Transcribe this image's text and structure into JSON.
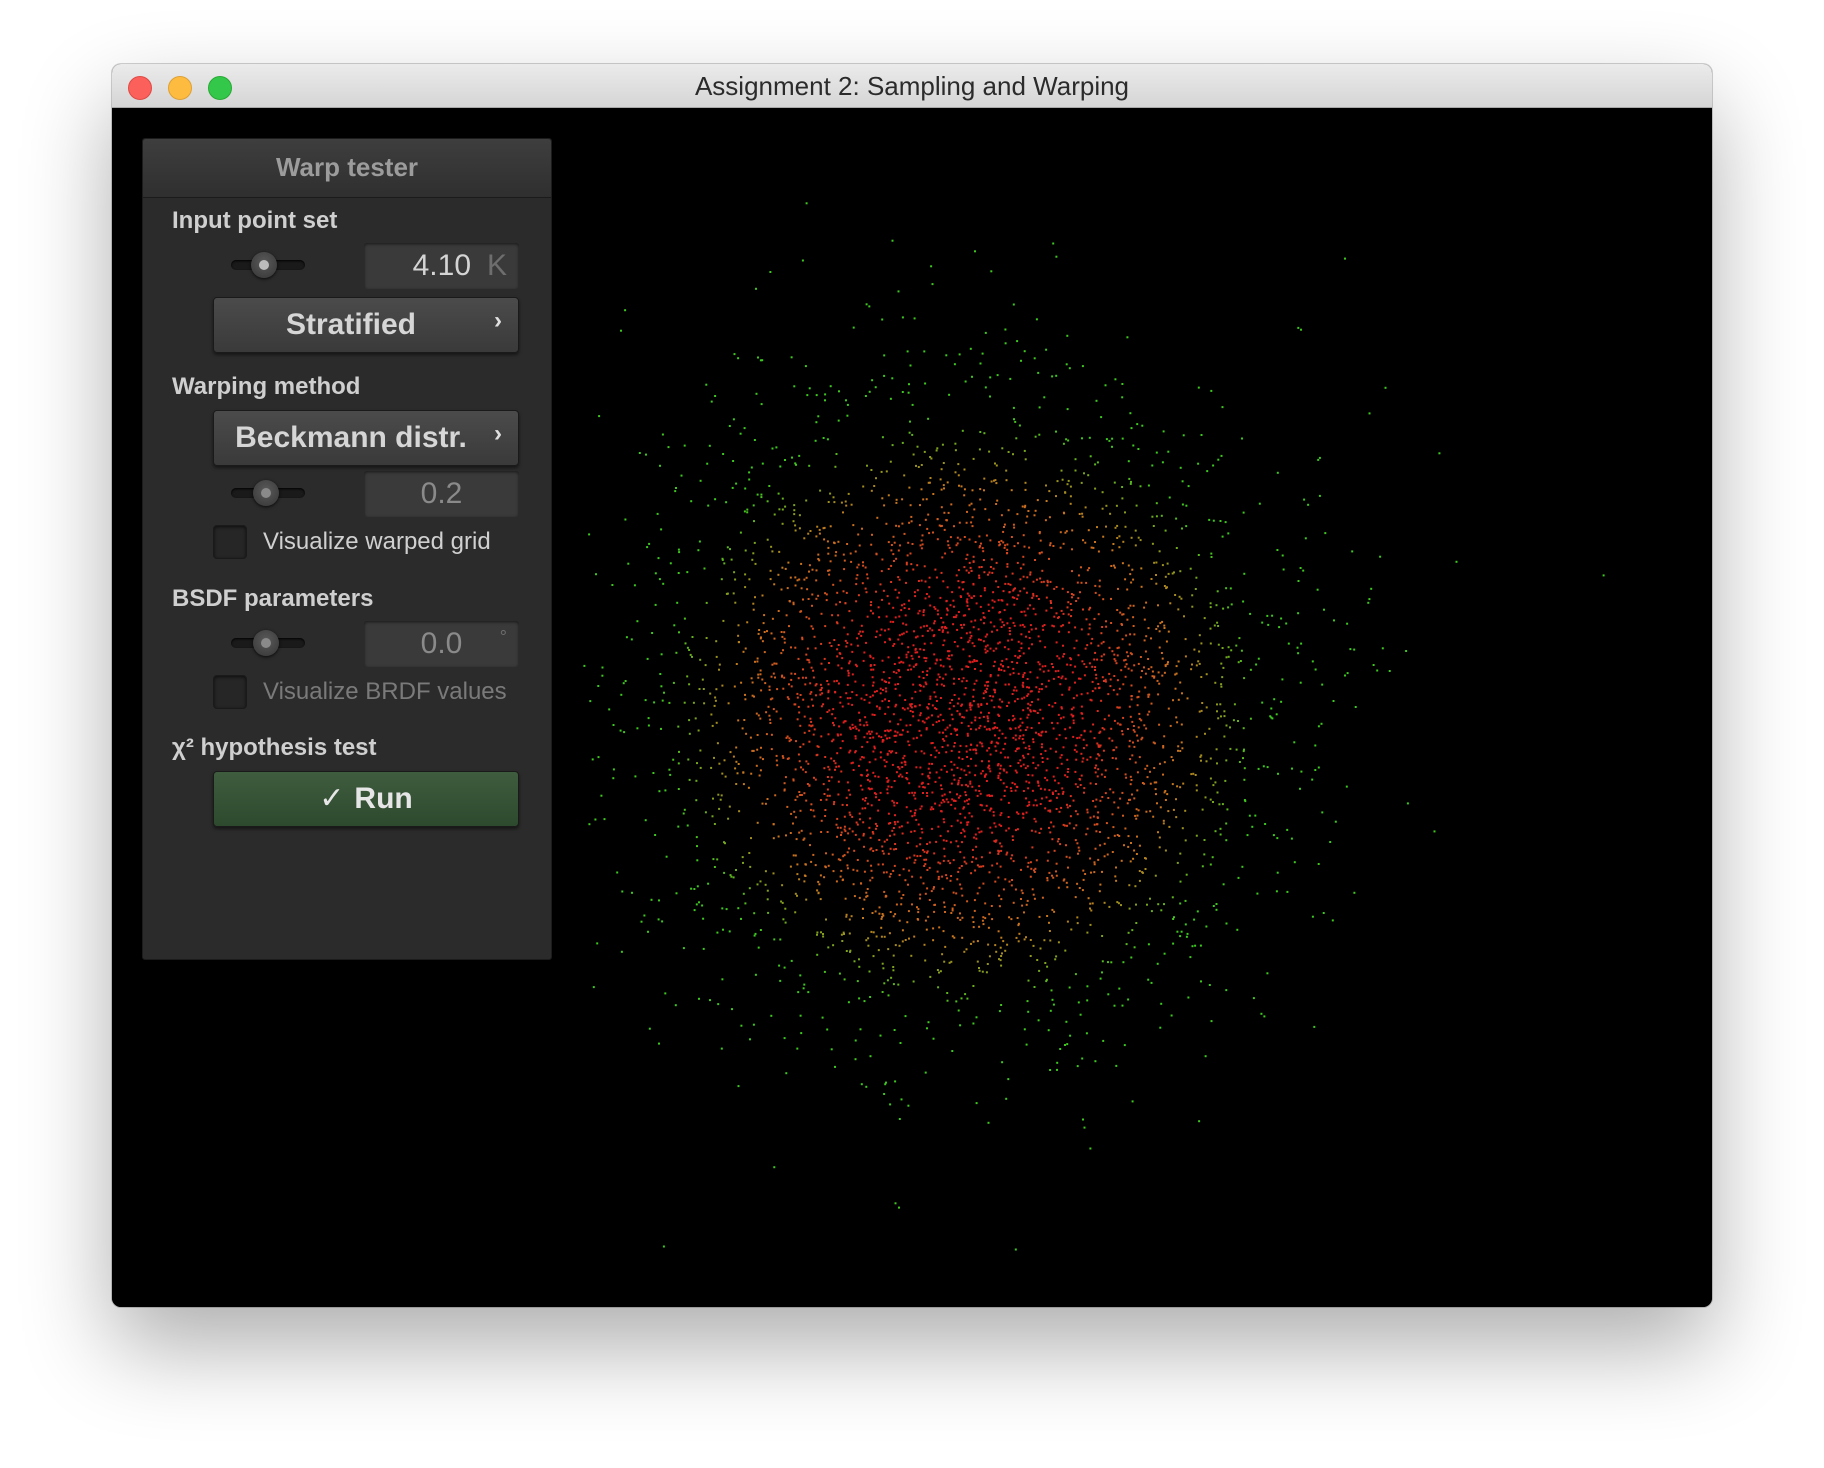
{
  "window": {
    "title": "Assignment 2: Sampling and Warping"
  },
  "panel": {
    "title": "Warp tester",
    "input_point_set": {
      "label": "Input point set",
      "count_value": "4.10",
      "count_unit": "K",
      "slider_level": 0.48,
      "method": "Stratified"
    },
    "warping_method": {
      "label": "Warping method",
      "method": "Beckmann distr.",
      "param_value": "0.2",
      "slider_level": 0.5,
      "visualize_grid_label": "Visualize warped grid",
      "visualize_grid_checked": false
    },
    "bsdf": {
      "label": "BSDF parameters",
      "angle_value": "0.0",
      "angle_unit": "°",
      "slider_level": 0.5,
      "visualize_brdf_label": "Visualize BRDF values",
      "visualize_brdf_checked": false
    },
    "chi2": {
      "label": "χ² hypothesis test",
      "run_label": "Run",
      "run_icon": "✓"
    }
  },
  "icons": {
    "popup_chevron": "›"
  },
  "colors": {
    "center_points": "#e01e1e",
    "mid_points": "#c8781e",
    "outer_points": "#3cc81e",
    "run_button": "#355235"
  }
}
